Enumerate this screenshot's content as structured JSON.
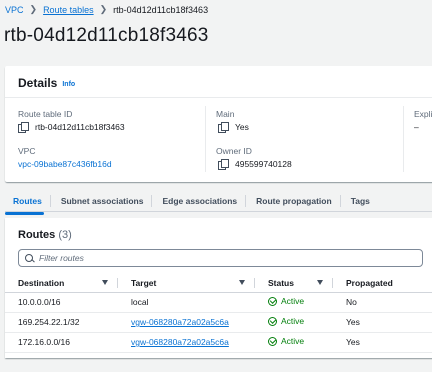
{
  "breadcrumb": {
    "items": [
      "VPC",
      "Route tables",
      "rtb-04d12d11cb18f3463"
    ]
  },
  "page_title": "rtb-04d12d11cb18f3463",
  "details": {
    "heading": "Details",
    "info_link": "Info",
    "fields": {
      "route_table_id_label": "Route table ID",
      "route_table_id_value": "rtb-04d12d11cb18f3463",
      "main_label": "Main",
      "main_value": "Yes",
      "explicit_label": "Expli",
      "explicit_value": "–",
      "vpc_label": "VPC",
      "vpc_value": "vpc-09babe87c436fb16d",
      "owner_label": "Owner ID",
      "owner_value": "495599740128"
    }
  },
  "tabs": [
    "Routes",
    "Subnet associations",
    "Edge associations",
    "Route propagation",
    "Tags"
  ],
  "routes": {
    "heading": "Routes",
    "count": "(3)",
    "search_placeholder": "Filter routes",
    "columns": [
      "Destination",
      "Target",
      "Status",
      "Propagated"
    ],
    "rows": [
      {
        "destination": "10.0.0.0/16",
        "target": "local",
        "status": "Active",
        "propagated": "No"
      },
      {
        "destination": "169.254.22.1/32",
        "target": "vgw-068280a72a02a5c6a",
        "status": "Active",
        "propagated": "Yes"
      },
      {
        "destination": "172.16.0.0/16",
        "target": "vgw-068280a72a02a5c6a",
        "status": "Active",
        "propagated": "Yes"
      }
    ]
  },
  "colors": {
    "link": "#0972d3",
    "success": "#037f0c",
    "background": "#f2f3f3"
  },
  "icons": [
    "chevron-right-icon",
    "copy-icon",
    "search-icon",
    "sort-caret-icon",
    "status-check-icon"
  ]
}
